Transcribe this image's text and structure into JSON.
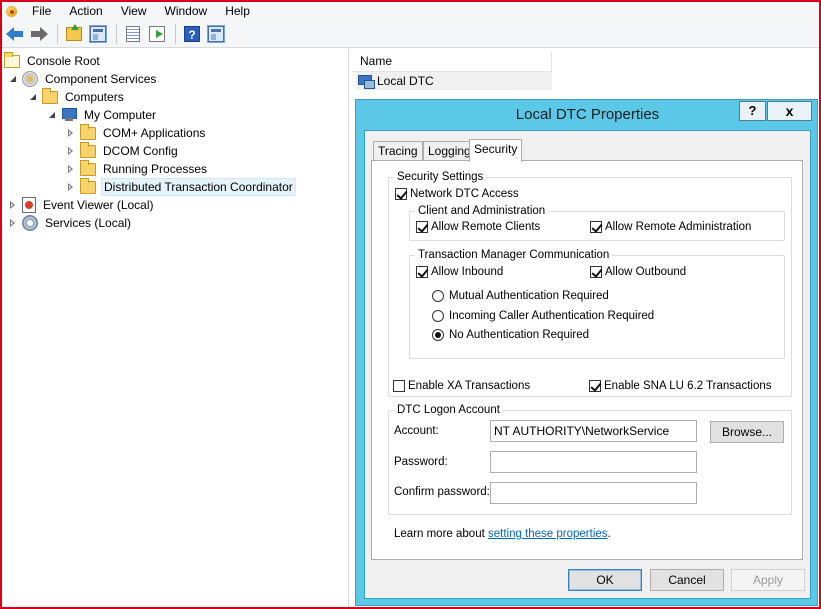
{
  "menu": {
    "items": [
      "File",
      "Action",
      "View",
      "Window",
      "Help"
    ]
  },
  "toolbar": {
    "buttons": [
      "back-icon",
      "forward-icon",
      "up-folder-icon",
      "show-hide-tree-icon",
      "properties-list-icon",
      "export-list-icon",
      "help-icon",
      "show-hide-action-pane-icon"
    ],
    "help_glyph": "?"
  },
  "tree": {
    "console_root": "Console Root",
    "component_services": "Component Services",
    "computers": "Computers",
    "my_computer": "My Computer",
    "com_apps": "COM+ Applications",
    "dcom_config": "DCOM Config",
    "running_processes": "Running Processes",
    "dtc": "Distributed Transaction Coordinator",
    "event_viewer": "Event Viewer (Local)",
    "services": "Services (Local)"
  },
  "list": {
    "header_name": "Name",
    "item": "Local DTC"
  },
  "dialog": {
    "title": "Local DTC Properties",
    "help_button": "?",
    "close_button": "x",
    "tabs": [
      "Tracing",
      "Logging",
      "Security"
    ],
    "active_tab": "Security",
    "security_settings": {
      "legend": "Security Settings",
      "network_dtc_access": {
        "label": "Network DTC Access",
        "checked": true
      },
      "client_admin": {
        "legend": "Client and Administration",
        "allow_remote_clients": {
          "label": "Allow Remote Clients",
          "checked": true
        },
        "allow_remote_admin": {
          "label": "Allow Remote Administration",
          "checked": true
        }
      },
      "tm_comm": {
        "legend": "Transaction Manager Communication",
        "allow_inbound": {
          "label": "Allow Inbound",
          "checked": true
        },
        "allow_outbound": {
          "label": "Allow Outbound",
          "checked": true
        },
        "auth_options": [
          {
            "label": "Mutual Authentication Required",
            "selected": false
          },
          {
            "label": "Incoming Caller Authentication Required",
            "selected": false
          },
          {
            "label": "No Authentication Required",
            "selected": true
          }
        ]
      },
      "enable_xa": {
        "label": "Enable XA Transactions",
        "checked": false
      },
      "enable_sna": {
        "label": "Enable SNA LU 6.2 Transactions",
        "checked": true
      }
    },
    "logon_account": {
      "legend": "DTC Logon Account",
      "account_label": "Account:",
      "account_value": "NT AUTHORITY\\NetworkService",
      "browse_label": "Browse...",
      "password_label": "Password:",
      "password_value": "",
      "confirm_label": "Confirm password:",
      "confirm_value": ""
    },
    "learn_more_prefix": "Learn more about ",
    "learn_more_link": "setting these properties",
    "learn_more_suffix": ".",
    "buttons": {
      "ok": "OK",
      "cancel": "Cancel",
      "apply": "Apply"
    }
  },
  "colors": {
    "window_frame_red": "#d9001b",
    "dialog_frame": "#5bc8e8",
    "link": "#0066cc"
  }
}
